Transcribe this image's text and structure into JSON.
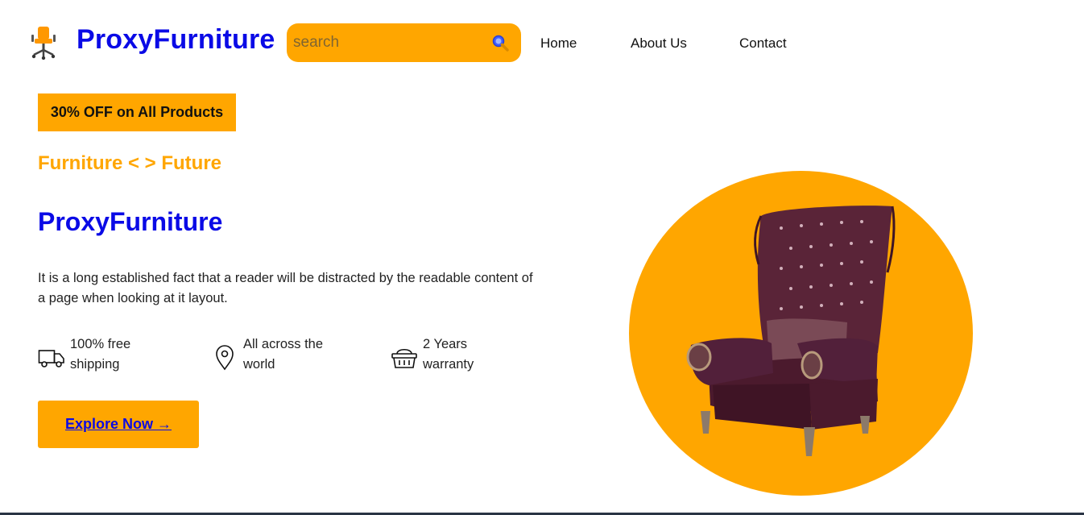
{
  "brand": {
    "name": "ProxyFurniture",
    "icon": "office-chair-icon"
  },
  "search": {
    "placeholder": "search",
    "value": "",
    "icon": "magnifier-icon"
  },
  "nav": {
    "items": [
      {
        "label": "Home"
      },
      {
        "label": "About Us"
      },
      {
        "label": "Contact"
      }
    ]
  },
  "hero": {
    "badge": "30% OFF on All Products",
    "tagline": "Furniture < > Future",
    "title": "ProxyFurniture",
    "description": "It is a long established fact that a reader will be distracted by the readable content of a page when looking at it layout.",
    "features": [
      {
        "icon": "truck-icon",
        "line1": "100% free",
        "line2": "shipping"
      },
      {
        "icon": "location-pin-icon",
        "line1": "All across the",
        "line2": "world"
      },
      {
        "icon": "basket-icon",
        "line1": "2 Years",
        "line2": "warranty"
      }
    ],
    "cta_label": "Explore Now →",
    "image": "armchair-image"
  },
  "colors": {
    "accent": "#ffa600",
    "brand": "#0a0ae6",
    "text": "#111111",
    "chair": "#5a2438"
  }
}
